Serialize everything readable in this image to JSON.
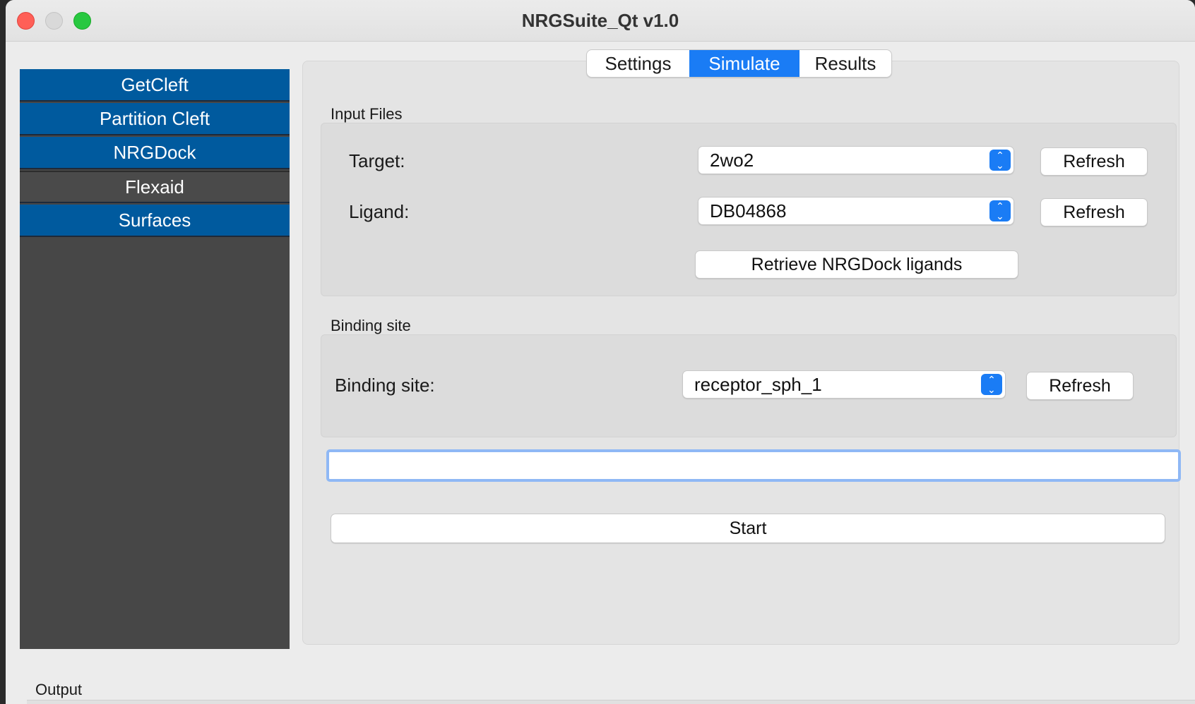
{
  "window": {
    "title": "NRGSuite_Qt v1.0"
  },
  "sidebar": {
    "items": [
      {
        "label": "GetCleft"
      },
      {
        "label": "Partition Cleft"
      },
      {
        "label": "NRGDock"
      },
      {
        "label": "Flexaid"
      },
      {
        "label": "Surfaces"
      }
    ]
  },
  "tabs": [
    {
      "label": "Settings"
    },
    {
      "label": "Simulate",
      "selected": true
    },
    {
      "label": "Results"
    }
  ],
  "input_files": {
    "group_label": "Input Files",
    "target_label": "Target:",
    "target_value": "2wo2",
    "ligand_label": "Ligand:",
    "ligand_value": "DB04868",
    "refresh_label": "Refresh",
    "retrieve_label": "Retrieve NRGDock ligands"
  },
  "binding_site": {
    "group_label": "Binding site",
    "field_label": "Binding site:",
    "value": "receptor_sph_1",
    "refresh_label": "Refresh"
  },
  "status_input": {
    "value": ""
  },
  "start_label": "Start",
  "output": {
    "label": "Output"
  },
  "colors": {
    "accent": "#1a7cf5",
    "sidebar_active": "#005a9e",
    "sidebar_bg": "#474747"
  }
}
